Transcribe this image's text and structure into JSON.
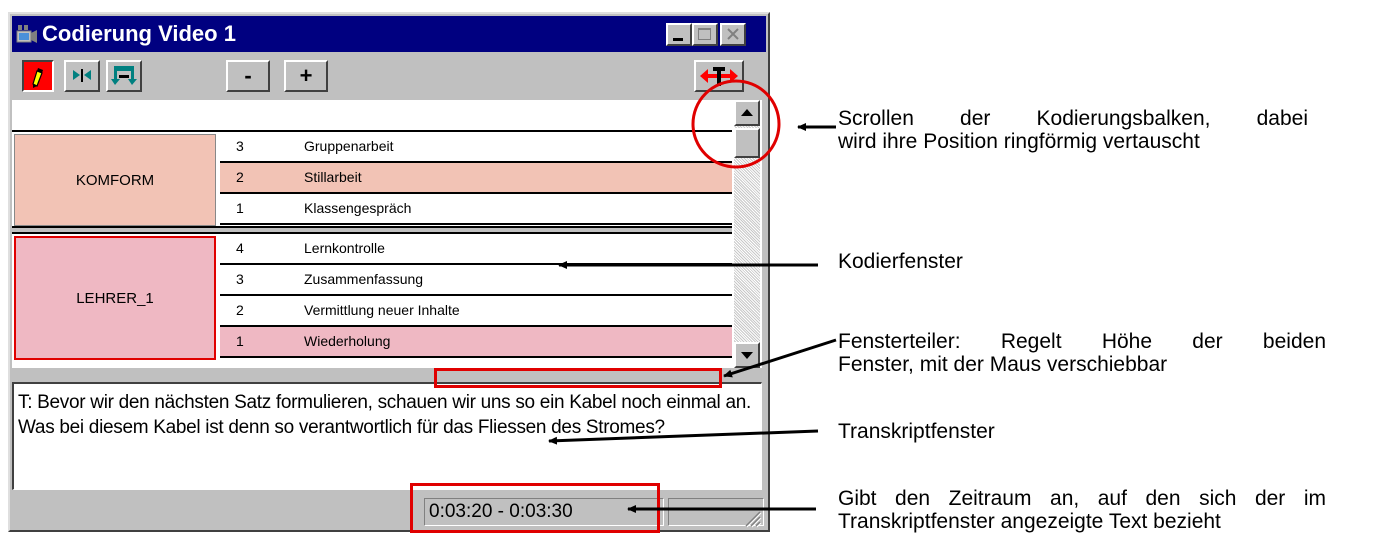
{
  "window": {
    "title": "Codierung Video 1",
    "toolbar": {
      "minus_label": "-",
      "plus_label": "+"
    },
    "groups": [
      {
        "label": "KOMFORM",
        "color": "#f2c3b5",
        "rows": [
          {
            "num": "3",
            "label": "Gruppenarbeit",
            "selected": false
          },
          {
            "num": "2",
            "label": "Stillarbeit",
            "selected": true
          },
          {
            "num": "1",
            "label": "Klassengespräch",
            "selected": false
          }
        ]
      },
      {
        "label": "LEHRER_1",
        "color": "#efb8c3",
        "rows": [
          {
            "num": "4",
            "label": "Lernkontrolle",
            "selected": false
          },
          {
            "num": "3",
            "label": "Zusammenfassung",
            "selected": false
          },
          {
            "num": "2",
            "label": "Vermittlung neuer Inhalte",
            "selected": false
          },
          {
            "num": "1",
            "label": "Wiederholung",
            "selected": true
          }
        ]
      }
    ],
    "transcript": "T: Bevor wir den nächsten Satz formulieren, schauen wir uns so ein Kabel noch einmal an. Was bei diesem Kabel ist denn so verantwortlich für das Fliessen des Stromes?",
    "status_time": "0:03:20 - 0:03:30"
  },
  "annotations": {
    "scroll_line1": "Scrollen der Kodierungsbalken, dabei",
    "scroll_line2": "wird ihre Position ringförmig vertauscht",
    "kodierfenster": "Kodierfenster",
    "splitter_line1": "Fensterteiler: Regelt Höhe der beiden",
    "splitter_line2": "Fenster, mit der Maus verschiebbar",
    "transkript": "Transkriptfenster",
    "time_line1": "Gibt den Zeitraum an, auf den sich der im",
    "time_line2": "Transkriptfenster angezeigte Text bezieht"
  },
  "colors": {
    "titlebar": "#000080",
    "highlight": "#e00000"
  }
}
